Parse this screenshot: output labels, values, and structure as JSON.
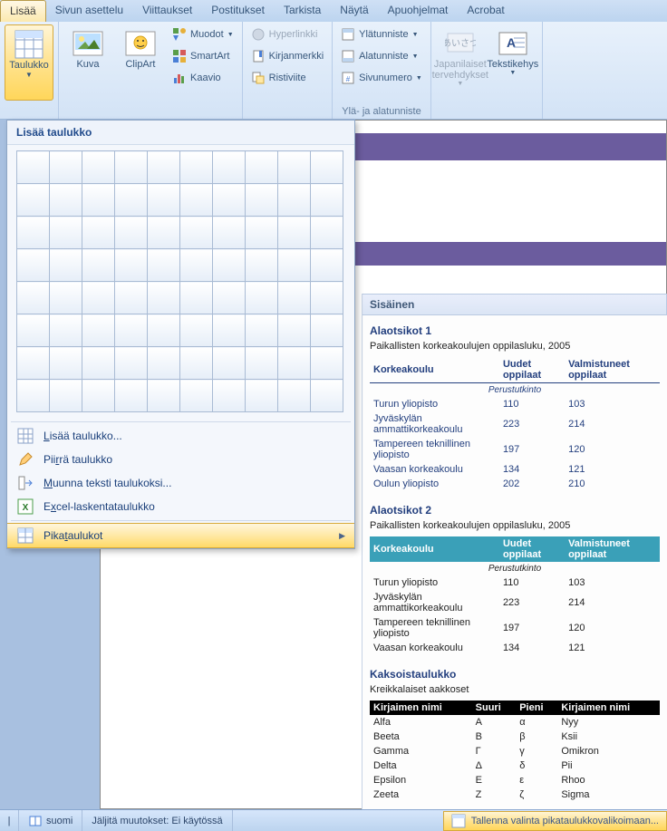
{
  "tabs": [
    "Lisää",
    "Sivun asettelu",
    "Viittaukset",
    "Postitukset",
    "Tarkista",
    "Näytä",
    "Apuohjelmat",
    "Acrobat"
  ],
  "active_tab_index": 0,
  "ribbon": {
    "taulukko": "Taulukko",
    "kuva": "Kuva",
    "clipart": "ClipArt",
    "muodot": "Muodot",
    "smartart": "SmartArt",
    "kaavio": "Kaavio",
    "hyperlinkki": "Hyperlinkki",
    "kirjanmerkki": "Kirjanmerkki",
    "ristiviite": "Ristiviite",
    "ylatunniste": "Ylätunniste",
    "alatunniste": "Alatunniste",
    "sivunumero": "Sivunumero",
    "grouplabel_hf": "Ylä- ja alatunniste",
    "japanilaiset": "Japanilaiset tervehdykset",
    "tekstikehys": "Tekstikehys"
  },
  "dropdown": {
    "title": "Lisää taulukko",
    "grid_cols": 10,
    "grid_rows": 8,
    "items": {
      "insert": {
        "pre": "",
        "u": "L",
        "post": "isää taulukko..."
      },
      "draw": {
        "pre": "Pii",
        "u": "r",
        "post": "rä taulukko"
      },
      "convert": {
        "pre": "",
        "u": "M",
        "post": "uunna teksti taulukoksi..."
      },
      "excel": {
        "pre": "E",
        "u": "x",
        "post": "cel-laskentataulukko"
      },
      "quick": {
        "pre": "Pika",
        "u": "t",
        "post": "aulukot"
      }
    }
  },
  "gallery": {
    "header": "Sisäinen",
    "sec1": {
      "title": "Alaotsikot 1",
      "caption": "Paikallisten korkeakoulujen oppilasluku, 2005",
      "cols": [
        "Korkeakoulu",
        "Uudet oppilaat",
        "Valmistuneet oppilaat"
      ],
      "sub": "Perustutkinto",
      "rows": [
        [
          "Turun yliopisto",
          "110",
          "103"
        ],
        [
          "Jyväskylän ammattikorkeakoulu",
          "223",
          "214"
        ],
        [
          "Tampereen teknillinen yliopisto",
          "197",
          "120"
        ],
        [
          "Vaasan korkeakoulu",
          "134",
          "121"
        ],
        [
          "Oulun yliopisto",
          "202",
          "210"
        ]
      ]
    },
    "sec2": {
      "title": "Alaotsikot 2",
      "caption": "Paikallisten korkeakoulujen oppilasluku, 2005",
      "cols": [
        "Korkeakoulu",
        "Uudet oppilaat",
        "Valmistuneet oppilaat"
      ],
      "sub": "Perustutkinto",
      "rows": [
        [
          "Turun yliopisto",
          "110",
          "103"
        ],
        [
          "Jyväskylän ammattikorkeakoulu",
          "223",
          "214"
        ],
        [
          "Tampereen teknillinen yliopisto",
          "197",
          "120"
        ],
        [
          "Vaasan korkeakoulu",
          "134",
          "121"
        ]
      ]
    },
    "sec3": {
      "title": "Kaksoistaulukko",
      "caption": "Kreikkalaiset aakkoset",
      "cols": [
        "Kirjaimen nimi",
        "Suuri",
        "Pieni",
        "Kirjaimen nimi"
      ],
      "rows": [
        [
          "Alfa",
          "A",
          "α",
          "Nyy"
        ],
        [
          "Beeta",
          "B",
          "β",
          "Ksii"
        ],
        [
          "Gamma",
          "Γ",
          "γ",
          "Omikron"
        ],
        [
          "Delta",
          "Δ",
          "δ",
          "Pii"
        ],
        [
          "Epsilon",
          "E",
          "ε",
          "Rhoo"
        ],
        [
          "Zeeta",
          "Z",
          "ζ",
          "Sigma"
        ]
      ]
    }
  },
  "status": {
    "lang": "suomi",
    "track": "Jäljitä muutokset: Ei käytössä",
    "save_sel": "Tallenna valinta pikataulukkovalikoimaan..."
  }
}
